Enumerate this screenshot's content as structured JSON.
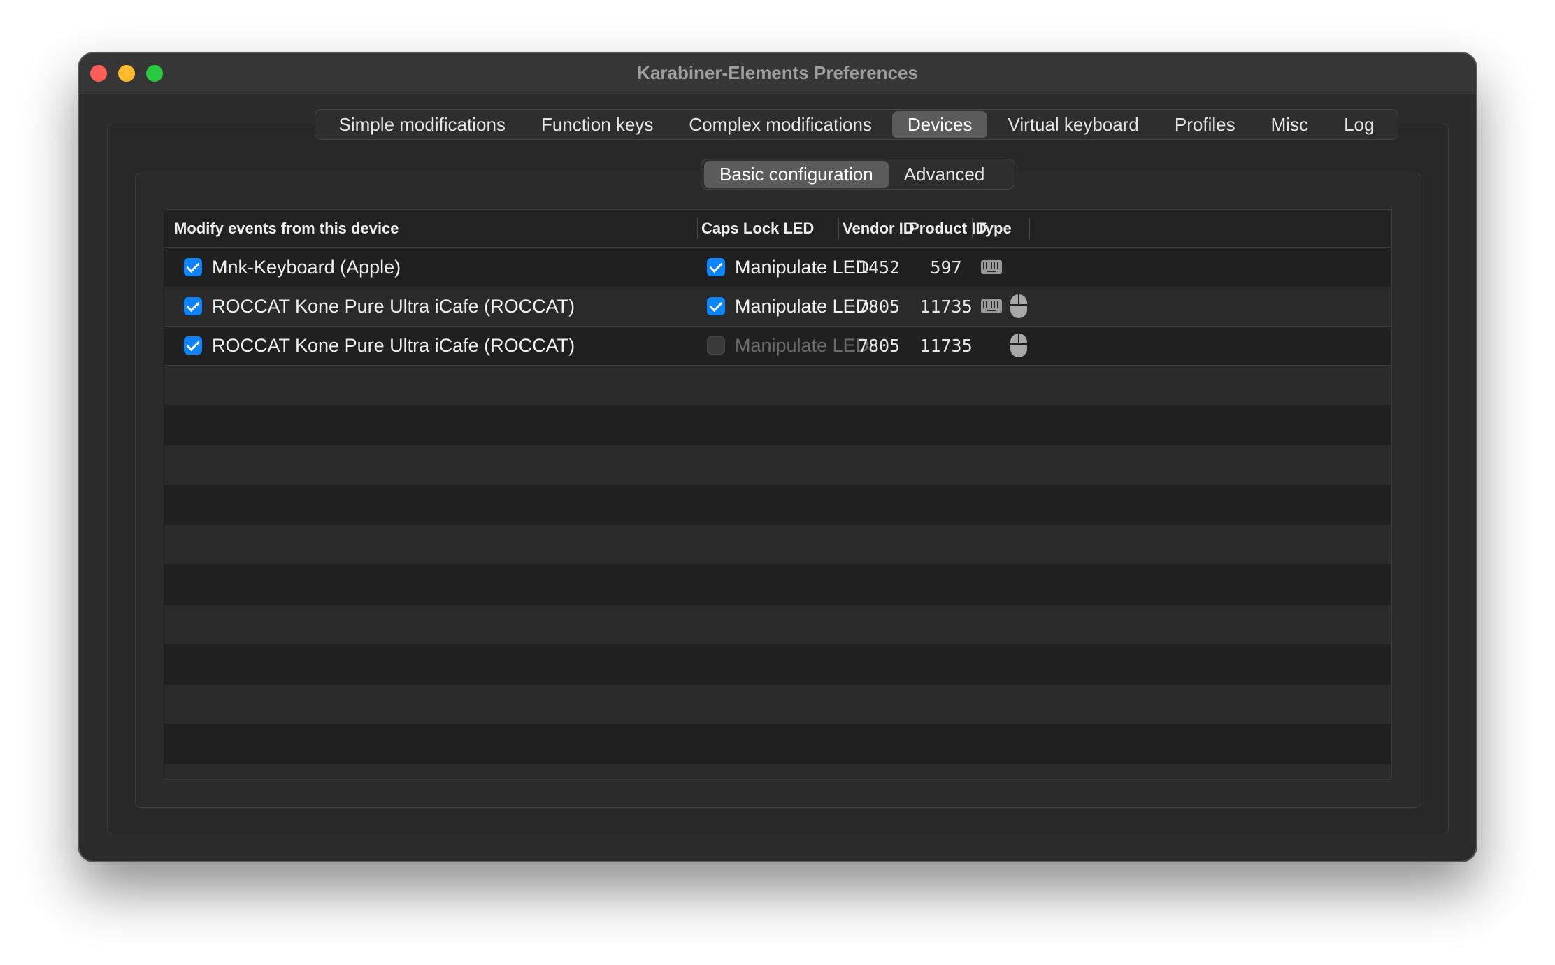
{
  "window": {
    "title": "Karabiner-Elements Preferences"
  },
  "tabs": [
    {
      "label": "Simple modifications"
    },
    {
      "label": "Function keys"
    },
    {
      "label": "Complex modifications"
    },
    {
      "label": "Devices"
    },
    {
      "label": "Virtual keyboard"
    },
    {
      "label": "Profiles"
    },
    {
      "label": "Misc"
    },
    {
      "label": "Log"
    }
  ],
  "active_tab": "Devices",
  "subtabs": [
    {
      "label": "Basic configuration"
    },
    {
      "label": "Advanced"
    }
  ],
  "active_subtab": "Basic configuration",
  "table": {
    "headers": {
      "device": "Modify events from this device",
      "caps": "Caps Lock LED",
      "vendor": "Vendor ID",
      "product": "Product ID",
      "type": "Type"
    },
    "rows": [
      {
        "device": "Mnk-Keyboard (Apple)",
        "modify": true,
        "led_label": "Manipulate LED",
        "led_checked": true,
        "led_enabled": true,
        "vendor_id": "1452",
        "product_id": "597",
        "types": [
          "keyboard-icon"
        ]
      },
      {
        "device": "ROCCAT Kone Pure Ultra iCafe (ROCCAT)",
        "modify": true,
        "led_label": "Manipulate LED",
        "led_checked": true,
        "led_enabled": true,
        "vendor_id": "7805",
        "product_id": "11735",
        "types": [
          "keyboard-icon",
          "mouse-icon"
        ]
      },
      {
        "device": "ROCCAT Kone Pure Ultra iCafe (ROCCAT)",
        "modify": true,
        "led_label": "Manipulate LED",
        "led_checked": false,
        "led_enabled": false,
        "vendor_id": "7805",
        "product_id": "11735",
        "types": [
          "mouse-icon"
        ]
      }
    ]
  },
  "colors": {
    "accent": "#0a84ff",
    "window_bg": "#2b2b2b",
    "close": "#ff5f57",
    "minimize": "#febc2e",
    "zoom": "#28c840"
  }
}
